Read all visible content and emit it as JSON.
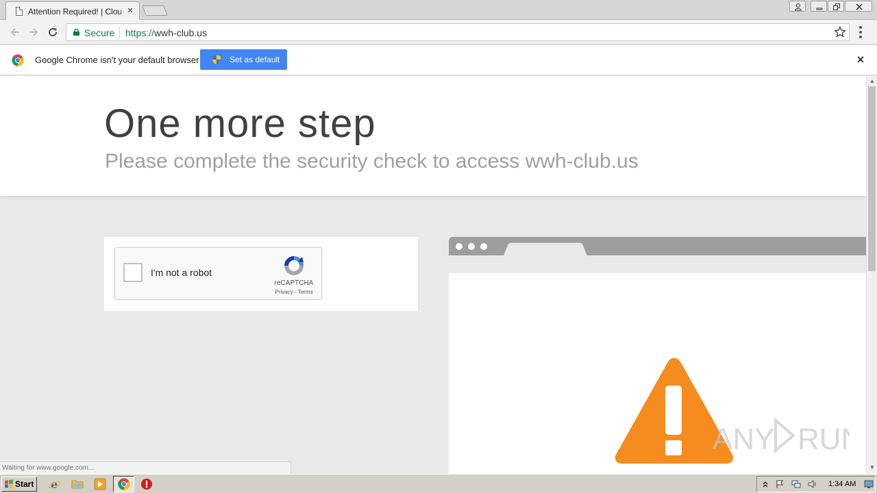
{
  "window": {
    "tab_title": "Attention Required! | Cloudf",
    "tab_close": "×"
  },
  "toolbar": {
    "security_label": "Secure",
    "url_scheme": "https://",
    "url_host": "wwh-club.us"
  },
  "infobar": {
    "message": "Google Chrome isn't your default browser",
    "button_label": "Set as default",
    "close": "×"
  },
  "page": {
    "heading": "One more step",
    "subheading": "Please complete the security check to access wwh-club.us",
    "captcha": {
      "checkbox_label": "I'm not a robot",
      "brand": "reCAPTCHA",
      "links": "Privacy - Terms"
    }
  },
  "status_bar": {
    "text": "Waiting for www.google.com..."
  },
  "taskbar": {
    "start_label": "Start",
    "clock": "1:34 AM"
  },
  "watermark": {
    "text": "ANY RUN"
  },
  "colors": {
    "chrome_blue": "#4285f4",
    "secure_green": "#0b8043",
    "warning_orange": "#f68b1f"
  }
}
